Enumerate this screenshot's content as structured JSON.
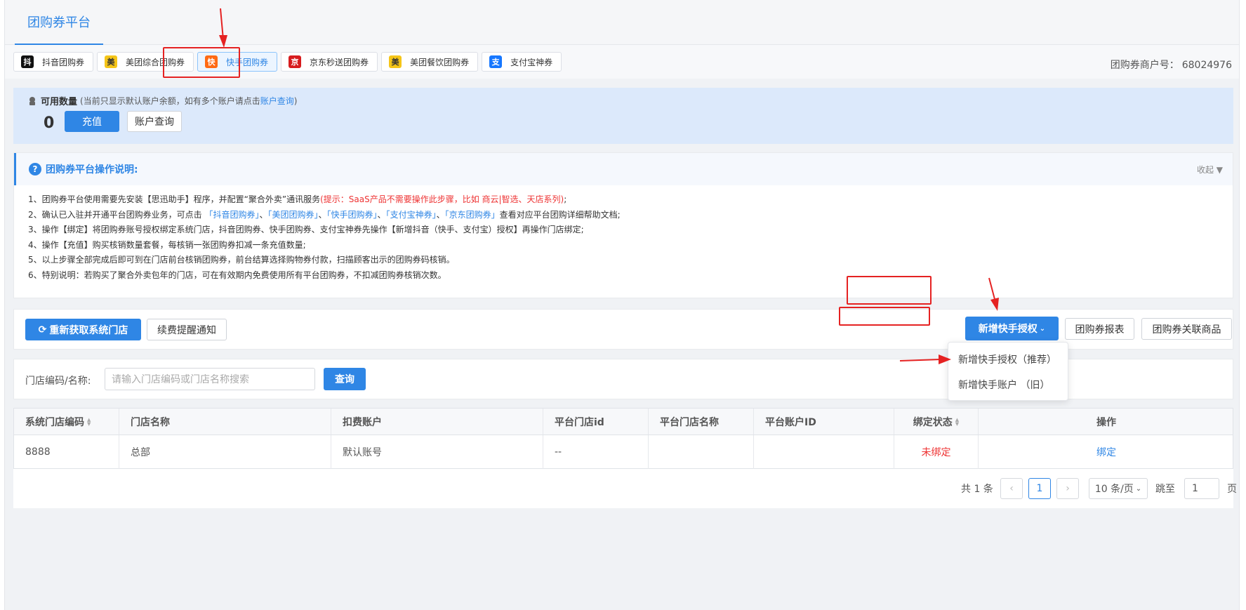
{
  "header": {
    "tab_label": "团购券平台"
  },
  "coupon_tabs": [
    {
      "label": "抖音团购券",
      "logo": "抖",
      "color": "#111111",
      "active": false
    },
    {
      "label": "美团综合团购券",
      "logo": "美",
      "color": "#f5c518",
      "active": false
    },
    {
      "label": "快手团购券",
      "logo": "快",
      "color": "#ff6a13",
      "active": true
    },
    {
      "label": "京东秒送团购券",
      "logo": "京",
      "color": "#d71c1e",
      "active": false
    },
    {
      "label": "美团餐饮团购券",
      "logo": "美",
      "color": "#f5c518",
      "active": false
    },
    {
      "label": "支付宝神券",
      "logo": "支",
      "color": "#1677ff",
      "active": false
    }
  ],
  "merchant": {
    "label": "团购券商户号：",
    "value": "68024976"
  },
  "balance": {
    "title": "可用数量",
    "hint_prefix": "(当前只显示默认账户余额，如有多个账户请点击",
    "hint_link": "账户查询",
    "hint_suffix": ")",
    "count": "0",
    "recharge_label": "充值",
    "account_query_label": "账户查询"
  },
  "notice": {
    "title": "团购券平台操作说明:",
    "collapse_label": "收起 ▼",
    "line1": "1、团购券平台使用需要先安装【思迅助手】程序，并配置“聚合外卖”通讯服务",
    "line1_red": "(提示：SaaS产品不需要操作此步骤，比如 商云|智选、天店系列)",
    "line1_end": ";",
    "line2_prefix": "2、确认已入驻并开通平台团购券业务，可点击",
    "line2_links": [
      "「抖音团购券」",
      "「美团团购券」",
      "「快手团购券」",
      "「支付宝神券」",
      "「京东团购券」"
    ],
    "line2_suffix": "查看对应平台团购详细帮助文档;",
    "line3": "3、操作【绑定】将团购券账号授权绑定系统门店，抖音团购券、快手团购券、支付宝神券先操作【新增抖音（快手、支付宝）授权】再操作门店绑定;",
    "line4": "4、操作【充值】购买核销数量套餐，每核销一张团购券扣减一条充值数量;",
    "line5": "5、以上步骤全部完成后即可到在门店前台核销团购券，前台结算选择购物券付款，扫描顾客出示的团购券码核销。",
    "line6": "6、特别说明：若购买了聚合外卖包年的门店，可在有效期内免费使用所有平台团购券，不扣减团购券核销次数。"
  },
  "toolbar": {
    "refresh_label": "重新获取系统门店",
    "renew_label": "续费提醒通知",
    "add_auth_label": "新增快手授权",
    "report_label": "团购券报表",
    "linked_goods_label": "团购券关联商品"
  },
  "dropdown": {
    "items": [
      "新增快手授权（推荐）",
      "新增快手账户 （旧）"
    ]
  },
  "search": {
    "label": "门店编码/名称:",
    "placeholder": "请输入门店编码或门店名称搜索",
    "button_label": "查询"
  },
  "table": {
    "columns": [
      "系统门店编码",
      "门店名称",
      "扣费账户",
      "平台门店id",
      "平台门店名称",
      "平台账户ID",
      "绑定状态",
      "操作"
    ],
    "rows": [
      {
        "code": "8888",
        "name": "总部",
        "account": "默认账号",
        "platform_store_id": "--",
        "platform_store_name": "",
        "platform_account_id": "",
        "status": "未绑定",
        "action": "绑定"
      }
    ]
  },
  "pagination": {
    "total": "共 1 条",
    "current_page": "1",
    "page_size": "10 条/页",
    "jump_label": "跳至",
    "jump_value": "1",
    "page_suffix": "页"
  },
  "colors": {
    "primary": "#2f86e5",
    "danger": "#e33333",
    "annotation": "#e52222"
  }
}
